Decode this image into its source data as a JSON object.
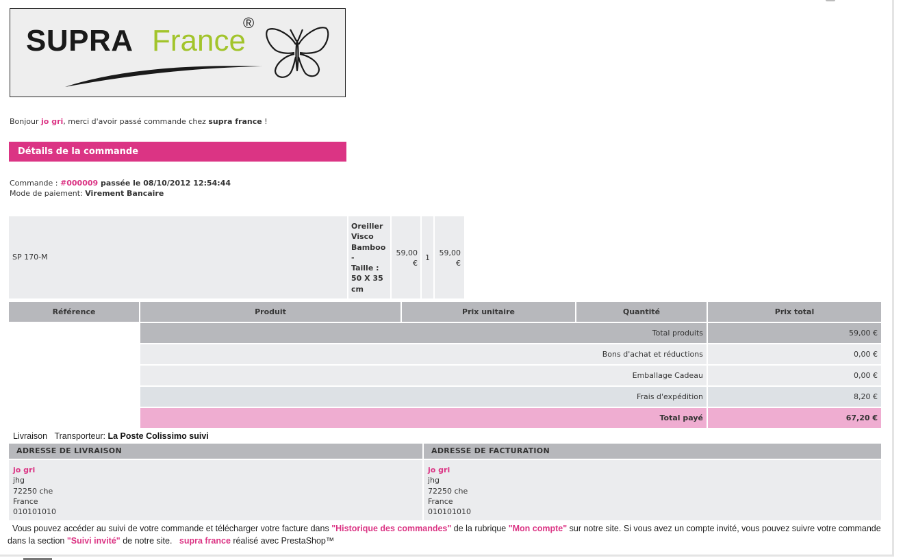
{
  "logo": {
    "brand_main": "SUPRA",
    "brand_secondary": "France",
    "registered_mark": "®",
    "colors": {
      "main": "#1a1a1a",
      "secondary": "#a2c42b"
    }
  },
  "greeting": {
    "prefix": "Bonjour ",
    "customer_name": "jo gri",
    "middle": ", merci d'avoir passé commande chez ",
    "shop_name": "supra france",
    "suffix": " !"
  },
  "section_title": "Détails de la commande",
  "order": {
    "label": "Commande : ",
    "number": "#000009",
    "placed_text": " passée le 08/10/2012 12:54:44",
    "payment_label": "Mode de paiement: ",
    "payment_value": "Virement Bancaire"
  },
  "product_row": {
    "reference": "SP 170-M",
    "name_lines": [
      "Oreiller",
      "Visco",
      "Bamboo",
      "-",
      "Taille :",
      "50 X 35",
      "cm"
    ],
    "unit_price_lines": [
      "59,00",
      "€"
    ],
    "quantity": "1",
    "total_price_lines": [
      "59,00",
      "€"
    ]
  },
  "table_headers": [
    "Référence",
    "Produit",
    "Prix unitaire",
    "Quantité",
    "Prix total"
  ],
  "summary": [
    {
      "label": "Total produits",
      "value": "59,00 €"
    },
    {
      "label": "Bons d'achat et réductions",
      "value": "0,00 €"
    },
    {
      "label": "Emballage Cadeau",
      "value": "0,00 €"
    },
    {
      "label": "Frais d'expédition",
      "value": "8,20 €"
    },
    {
      "label": "Total payé",
      "value": "67,20 €"
    }
  ],
  "delivery": {
    "label": "Livraison",
    "carrier_label": "Transporteur: ",
    "carrier_value": "La Poste Colissimo suivi"
  },
  "addresses": {
    "shipping": {
      "title": "ADRESSE DE LIVRAISON",
      "name": "jo gri",
      "line1": "jhg",
      "line2": "72250 che",
      "country": "France",
      "phone": "010101010"
    },
    "billing": {
      "title": "ADRESSE DE FACTURATION",
      "name": "jo gri",
      "line1": "jhg",
      "line2": "72250 che",
      "country": "France",
      "phone": "010101010"
    }
  },
  "footer": {
    "text1": "Vous pouvez accéder au suivi de votre commande et télécharger votre facture dans ",
    "link1": "\"Historique des commandes\"",
    "text2": " de la rubrique ",
    "link2": "\"Mon compte\"",
    "text3": " sur notre site. Si vous avez un compte invité, vous pouvez suivre votre commande dans la section ",
    "link3": "\"Suivi invité\"",
    "text4": " de notre site.   ",
    "shop_link": "supra france",
    "text5": " réalisé avec PrestaShop™"
  },
  "colors": {
    "accent": "#db3484",
    "header_gray": "#b7b8bc",
    "row_light": "#ebecee",
    "total_pink": "#efadd1"
  }
}
